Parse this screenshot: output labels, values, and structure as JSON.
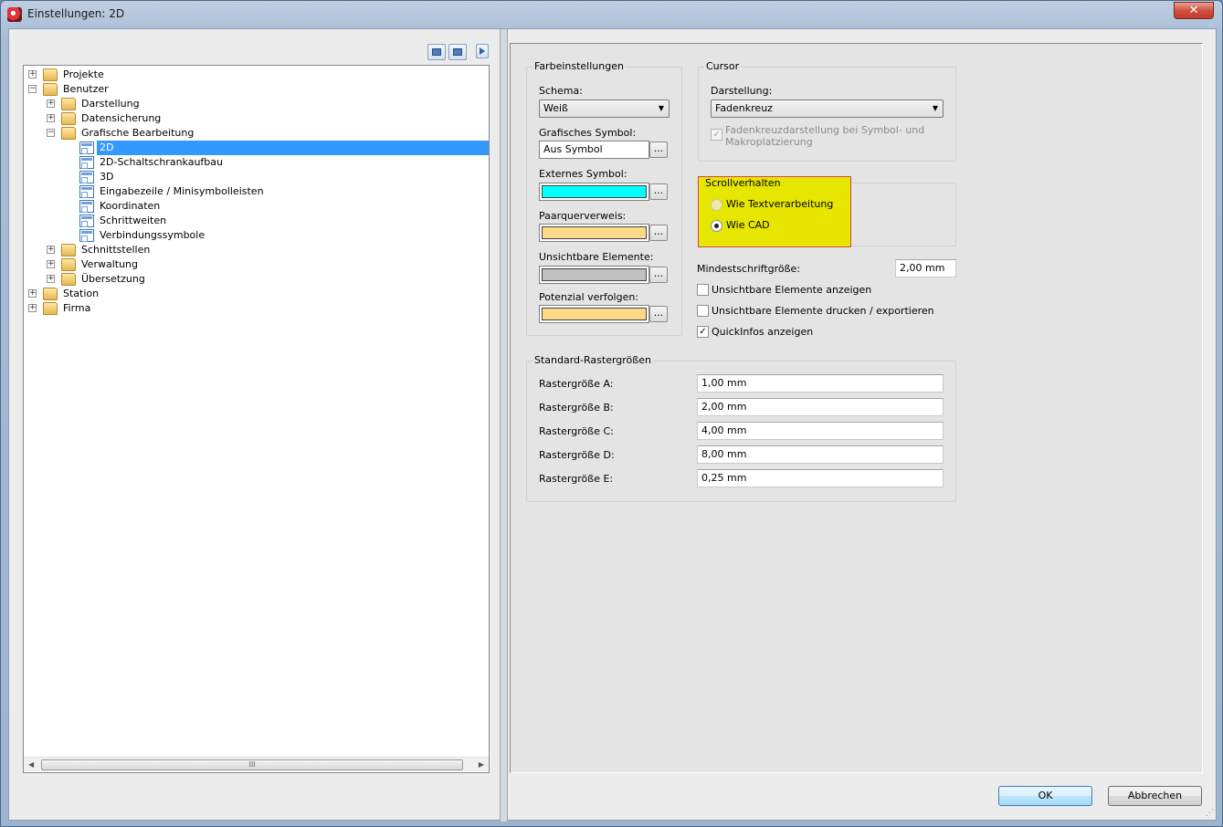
{
  "window": {
    "title": "Einstellungen: 2D",
    "close_label": "✕"
  },
  "tree": {
    "nodes": [
      {
        "label": "Projekte",
        "expander": "+"
      },
      {
        "label": "Benutzer",
        "expander": "−"
      },
      {
        "label": "Darstellung",
        "expander": "+"
      },
      {
        "label": "Datensicherung",
        "expander": "+"
      },
      {
        "label": "Grafische Bearbeitung",
        "expander": "−"
      },
      {
        "label": "2D",
        "selected": true
      },
      {
        "label": "2D-Schaltschrankaufbau"
      },
      {
        "label": "3D"
      },
      {
        "label": "Eingabezeile / Minisymbolleisten"
      },
      {
        "label": "Koordinaten"
      },
      {
        "label": "Schrittweiten"
      },
      {
        "label": "Verbindungssymbole"
      },
      {
        "label": "Schnittstellen",
        "expander": "+"
      },
      {
        "label": "Verwaltung",
        "expander": "+"
      },
      {
        "label": "Übersetzung",
        "expander": "+"
      },
      {
        "label": "Station",
        "expander": "+"
      },
      {
        "label": "Firma",
        "expander": "+"
      }
    ],
    "scroll_grip": "III"
  },
  "farbeinstellungen": {
    "title": "Farbeinstellungen",
    "schema_label": "Schema:",
    "schema_value": "Weiß",
    "grafisches_symbol_label": "Grafisches Symbol:",
    "grafisches_symbol_value": "Aus Symbol",
    "externes_symbol_label": "Externes Symbol:",
    "externes_symbol_color": "#00ffff",
    "paarquerverweis_label": "Paarquerverweis:",
    "paarquerverweis_color": "#ffd98a",
    "unsichtbare_label": "Unsichtbare Elemente:",
    "unsichtbare_color": "#c0c0c0",
    "potenzial_label": "Potenzial verfolgen:",
    "potenzial_color": "#ffd98a",
    "dots": "..."
  },
  "cursor": {
    "title": "Cursor",
    "darstellung_label": "Darstellung:",
    "darstellung_value": "Fadenkreuz",
    "fadenkreuz_check_line1": "Fadenkreuzdarstellung bei Symbol- und",
    "fadenkreuz_check_line2": "Makroplatzierung",
    "fadenkreuz_checked": true
  },
  "scrollverhalten": {
    "title": "Scrollverhalten",
    "option1": "Wie Textverarbeitung",
    "option2": "Wie CAD",
    "selected": "Wie CAD"
  },
  "misc": {
    "mindestschrift_label": "Mindestschriftgröße:",
    "mindestschrift_value": "2,00 mm",
    "unsichtbare_anzeigen": "Unsichtbare Elemente anzeigen",
    "unsichtbare_anzeigen_checked": false,
    "unsichtbare_drucken": "Unsichtbare Elemente drucken / exportieren",
    "unsichtbare_drucken_checked": false,
    "quickinfos": "QuickInfos anzeigen",
    "quickinfos_checked": true
  },
  "raster": {
    "title": "Standard-Rastergrößen",
    "rows": [
      {
        "label": "Rastergröße A:",
        "value": "1,00 mm"
      },
      {
        "label": "Rastergröße B:",
        "value": "2,00 mm"
      },
      {
        "label": "Rastergröße C:",
        "value": "4,00 mm"
      },
      {
        "label": "Rastergröße D:",
        "value": "8,00 mm"
      },
      {
        "label": "Rastergröße E:",
        "value": "0,25 mm"
      }
    ]
  },
  "buttons": {
    "ok": "OK",
    "cancel": "Abbrechen"
  }
}
